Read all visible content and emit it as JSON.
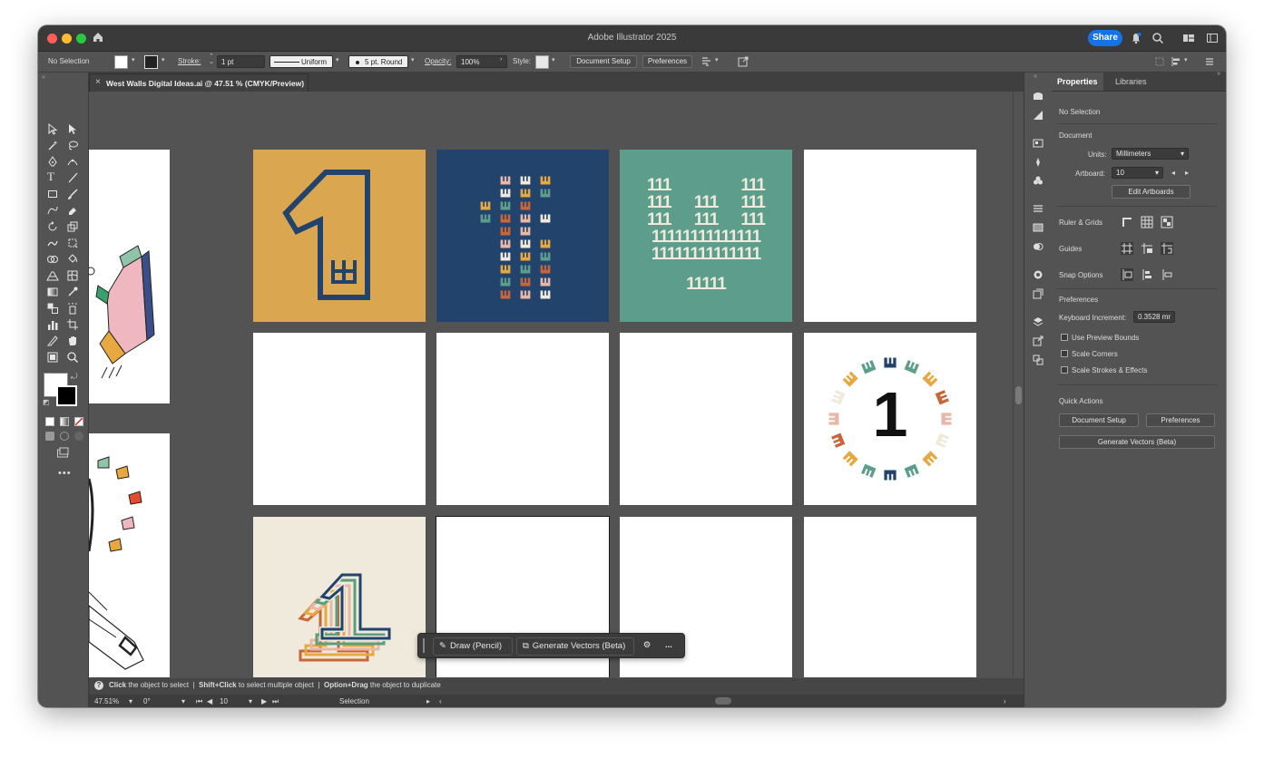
{
  "app": {
    "title": "Adobe Illustrator 2025",
    "share_label": "Share"
  },
  "control_bar": {
    "selection_label": "No Selection",
    "stroke_label": "Stroke:",
    "stroke_weight": "1 pt",
    "profile": "Uniform",
    "brush": "5 pt. Round",
    "opacity_label": "Opacity:",
    "opacity_value": "100%",
    "style_label": "Style:",
    "document_setup_label": "Document Setup",
    "preferences_label": "Preferences"
  },
  "document": {
    "tab_title": "West Walls Digital Ideas.ai @ 47.51 % (CMYK/Preview)"
  },
  "artboards": {
    "grid_digits": [
      "111",
      "111",
      "111",
      "111",
      "111",
      "111",
      "111",
      "111",
      "111",
      "11111111111111",
      "11111111111111",
      "11111"
    ],
    "center_digit": "1"
  },
  "context_bar": {
    "draw_label": "Draw (Pencil)",
    "generate_label": "Generate Vectors (Beta)",
    "more_label": "..."
  },
  "status": {
    "hint_click": "Click",
    "hint_click_desc": "the object to select",
    "hint_shift": "Shift+Click",
    "hint_shift_desc": "to select multiple object",
    "hint_option": "Option+Drag",
    "hint_option_desc": "the object to duplicate",
    "zoom": "47.51%",
    "rotation": "0°",
    "artboard_number": "10",
    "tool_name": "Selection"
  },
  "properties": {
    "tabs": [
      "Properties",
      "Libraries"
    ],
    "selection_state": "No Selection",
    "document_heading": "Document",
    "units_label": "Units:",
    "units_value": "Millimeters",
    "artboard_label": "Artboard:",
    "artboard_value": "10",
    "edit_artboards_label": "Edit Artboards",
    "ruler_grids_label": "Ruler & Grids",
    "guides_label": "Guides",
    "snap_options_label": "Snap Options",
    "preferences_heading": "Preferences",
    "keyboard_increment_label": "Keyboard Increment:",
    "keyboard_increment_value": "0.3528 mr",
    "use_preview_bounds_label": "Use Preview Bounds",
    "scale_corners_label": "Scale Corners",
    "scale_strokes_label": "Scale Strokes & Effects",
    "quick_actions_heading": "Quick Actions",
    "document_setup_label": "Document Setup",
    "preferences_label": "Preferences",
    "generate_vectors_label": "Generate Vectors (Beta)"
  },
  "colors": {
    "accent_blue": "#1473e6",
    "mustard": "#dba650",
    "navy": "#22436b",
    "teal": "#5c9e8b",
    "cream": "#efeadc",
    "rust": "#c8663a",
    "pink": "#e9b7a8",
    "green": "#5c9e7a"
  }
}
